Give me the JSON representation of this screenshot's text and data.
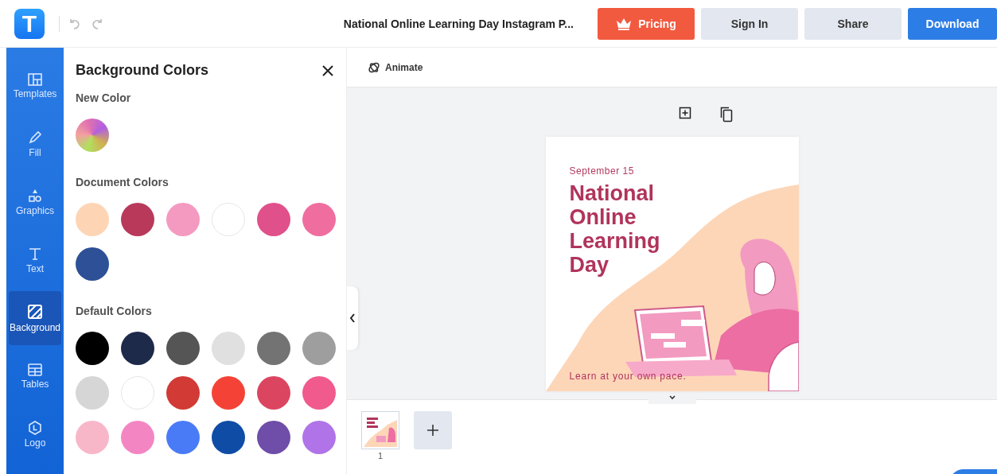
{
  "topbar": {
    "logo": "T",
    "document_title": "National Online Learning Day Instagram P...",
    "buttons": [
      {
        "label": "Pricing",
        "kind": "pricing"
      },
      {
        "label": "Sign In",
        "kind": "plain"
      },
      {
        "label": "Share",
        "kind": "plain"
      },
      {
        "label": "Download",
        "kind": "primary"
      }
    ]
  },
  "sidebar": {
    "items": [
      {
        "label": "Templates",
        "selected": false
      },
      {
        "label": "Fill",
        "selected": false
      },
      {
        "label": "Graphics",
        "selected": false
      },
      {
        "label": "Text",
        "selected": false
      },
      {
        "label": "Background",
        "selected": true
      },
      {
        "label": "Tables",
        "selected": false
      },
      {
        "label": "Logo",
        "selected": false
      }
    ]
  },
  "panel": {
    "title": "Background Colors",
    "sections": [
      {
        "heading": "New Color",
        "kind": "new"
      },
      {
        "heading": "Document Colors",
        "kind": "swatches",
        "swatches": [
          {
            "color": "#fdd5b5"
          },
          {
            "color": "#b9395a"
          },
          {
            "color": "#f49ac1"
          },
          {
            "color": "#ffffff"
          },
          {
            "color": "#e0508a"
          },
          {
            "color": "#f06da0"
          },
          {
            "color": "#2d5096"
          }
        ]
      },
      {
        "heading": "Default Colors",
        "kind": "swatches",
        "swatches": [
          {
            "color": "#000000"
          },
          {
            "color": "#1e2a4a"
          },
          {
            "color": "#555555"
          },
          {
            "color": "#e0e0e0"
          },
          {
            "color": "#737373"
          },
          {
            "color": "#9e9e9e"
          },
          {
            "color": "#d6d6d6"
          },
          {
            "color": "#ffffff"
          },
          {
            "color": "#d13a35"
          },
          {
            "color": "#f44336"
          },
          {
            "color": "#dc4560"
          },
          {
            "color": "#f05a8c"
          },
          {
            "color": "#f8b7c9"
          },
          {
            "color": "#f485c3"
          },
          {
            "color": "#4a7bf7"
          },
          {
            "color": "#0f4ca5"
          },
          {
            "color": "#6e4ea8"
          },
          {
            "color": "#b073e8"
          }
        ]
      }
    ]
  },
  "toolbar": {
    "animate": "Animate"
  },
  "design": {
    "date": "September 15",
    "headline": [
      "National",
      "Online",
      "Learning",
      "Day"
    ],
    "tagline": "Learn at your own pace."
  },
  "pages": [
    {
      "number": "1",
      "selected": true
    }
  ]
}
